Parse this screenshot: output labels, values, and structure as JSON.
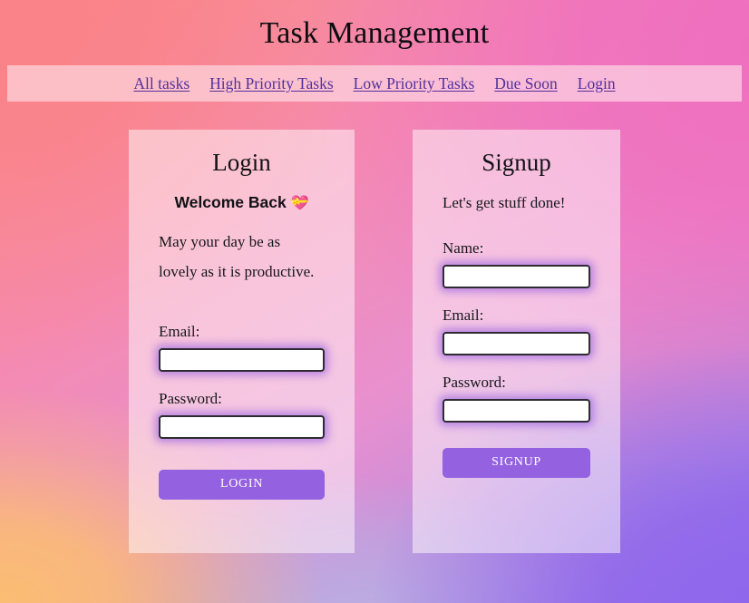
{
  "header": {
    "title": "Task Management"
  },
  "nav": {
    "items": [
      {
        "label": "All tasks"
      },
      {
        "label": "High Priority Tasks"
      },
      {
        "label": "Low Priority Tasks"
      },
      {
        "label": "Due Soon"
      },
      {
        "label": "Login"
      }
    ],
    "link_color": "#53309c",
    "bar_color": "#ffe4ea"
  },
  "login_card": {
    "title": "Login",
    "welcome_text": "Welcome Back",
    "welcome_emoji": "💝",
    "tagline_line1": "May your day be as",
    "tagline_line2": "lovely as it is productive.",
    "email_label": "Email:",
    "email_value": "",
    "email_placeholder": "",
    "password_label": "Password:",
    "password_value": "",
    "password_placeholder": "",
    "submit_label": "LOGIN"
  },
  "signup_card": {
    "title": "Signup",
    "tagline": "Let's get stuff done!",
    "name_label": "Name:",
    "name_value": "",
    "name_placeholder": "",
    "email_label": "Email:",
    "email_value": "",
    "email_placeholder": "",
    "password_label": "Password:",
    "password_value": "",
    "password_placeholder": "",
    "submit_label": "SIGNUP"
  },
  "theme": {
    "accent_purple": "#9461e0",
    "input_glow": "#965fe1",
    "input_border": "#2e2b33",
    "card_bg": "rgba(255,250,252,0.52)",
    "text_dark": "#121216",
    "bg_top_left": "#fa8289",
    "bg_top_right": "#ef6fbf",
    "bg_bottom_left": "#fbbd72",
    "bg_bottom_right": "#9370e8",
    "bg_bottom_center": "#bab2e2"
  }
}
